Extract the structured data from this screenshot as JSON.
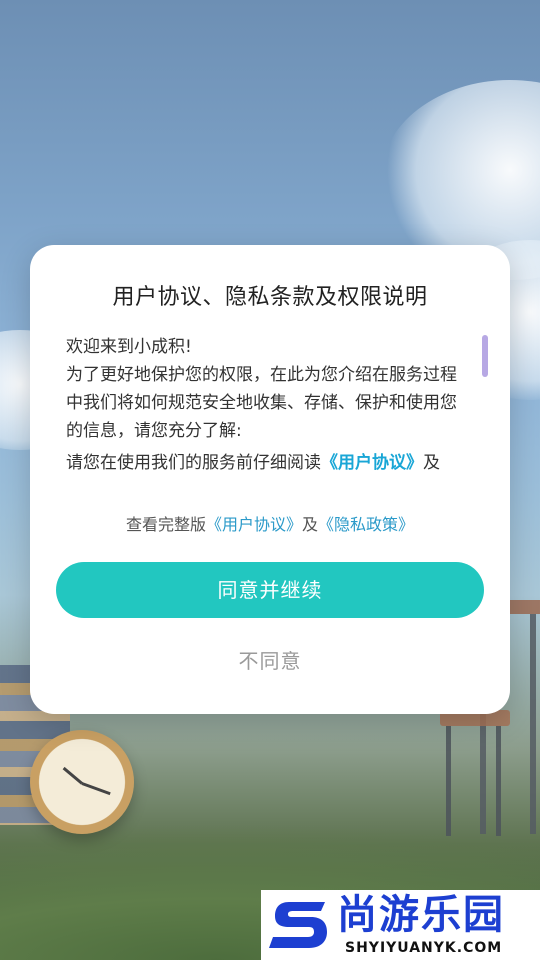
{
  "dialog": {
    "title": "用户协议、隐私条款及权限说明",
    "body": {
      "line1": "欢迎来到小成积!",
      "line2": "为了更好地保护您的权限，在此为您介绍在服务过程中我们将如何规范安全地收集、存储、保护和使用您的信息，请您充分了解:",
      "line3_prefix": "请您在使用我们的服务前仔细阅读",
      "line3_link": "《用户协议》",
      "line3_suffix": "及"
    },
    "full_links": {
      "prefix": "查看完整版",
      "user_agreement": "《用户协议》",
      "and": "及",
      "privacy_policy": "《隐私政策》"
    },
    "agree_label": "同意并继续",
    "disagree_label": "不同意"
  },
  "watermark": {
    "title": "尚游乐园",
    "subtitle": "SHYIYUANYK.COM"
  },
  "colors": {
    "accent": "#22c7c0",
    "link": "#19a6d6",
    "watermark_blue": "#1d3fd1"
  }
}
